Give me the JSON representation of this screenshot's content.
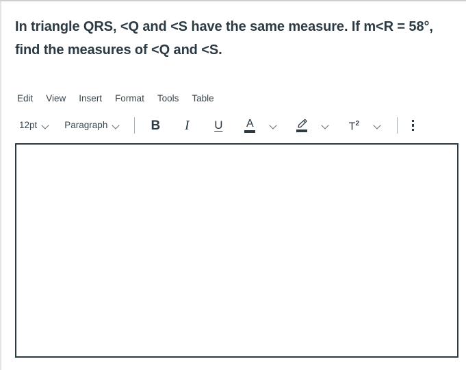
{
  "question": {
    "text": "In triangle QRS, <Q and <S have the same measure. If m<R = 58°, find the measures of <Q and <S."
  },
  "editor": {
    "menubar": [
      {
        "label": "Edit",
        "name": "menu-edit"
      },
      {
        "label": "View",
        "name": "menu-view"
      },
      {
        "label": "Insert",
        "name": "menu-insert"
      },
      {
        "label": "Format",
        "name": "menu-format"
      },
      {
        "label": "Tools",
        "name": "menu-tools"
      },
      {
        "label": "Table",
        "name": "menu-table"
      }
    ],
    "toolbar": {
      "font_size": "12pt",
      "block_format": "Paragraph",
      "bold_label": "B",
      "italic_label": "I",
      "underline_label": "U",
      "text_color_label": "A",
      "superscript_label": "T",
      "superscript_exponent": "2",
      "text_color_swatch": "#2c3a44",
      "highlight_color_swatch": "#2c3a44"
    },
    "content": {
      "value": "",
      "placeholder": ""
    },
    "border_color": "#2b3a42"
  }
}
